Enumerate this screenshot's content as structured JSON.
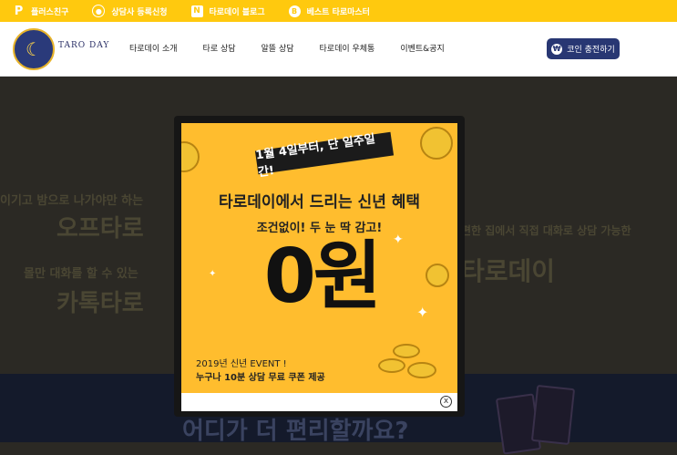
{
  "topbar": {
    "items": [
      {
        "label": "플러스친구",
        "icon": "p-icon"
      },
      {
        "label": "상담사 등록신청",
        "icon": "user-icon"
      },
      {
        "label": "타로데이 블로그",
        "icon": "naver-icon"
      },
      {
        "label": "베스트 타로마스터",
        "icon": "best-icon"
      }
    ]
  },
  "header": {
    "logo_text": "TARO DAY",
    "nav": [
      "타로데이 소개",
      "타로 상담",
      "알뜰 상담",
      "타로데이 우체통",
      "이벤트&공지"
    ],
    "coin_button": "코인 충전하기"
  },
  "background": {
    "line1": "이기고 밤으로 나가야만 하는",
    "heading1": "오프타로",
    "line2": "몰만 대화를 할 수 있는",
    "heading2": "카톡타로",
    "right_line": "편한 집에서 직접 대화로 상담 가능한",
    "right_heading": "타로데이",
    "bottom_heading": "어디가 더 편리할까요?"
  },
  "popup": {
    "ribbon": "1월 4일부터, 단 일주일간!",
    "title": "타로데이에서 드리는 신년 혜택",
    "subtitle": "조건없이! 두 눈 딱 감고!",
    "price": "0원",
    "event_line1": "2019년 신년 EVENT !",
    "event_line2": "누구나 10분 상담 무료 쿠폰 제공",
    "close_symbol": "x"
  },
  "colors": {
    "accent": "#ffc90e",
    "brand_navy": "#283773",
    "popup_bg": "#ffbd2e"
  }
}
